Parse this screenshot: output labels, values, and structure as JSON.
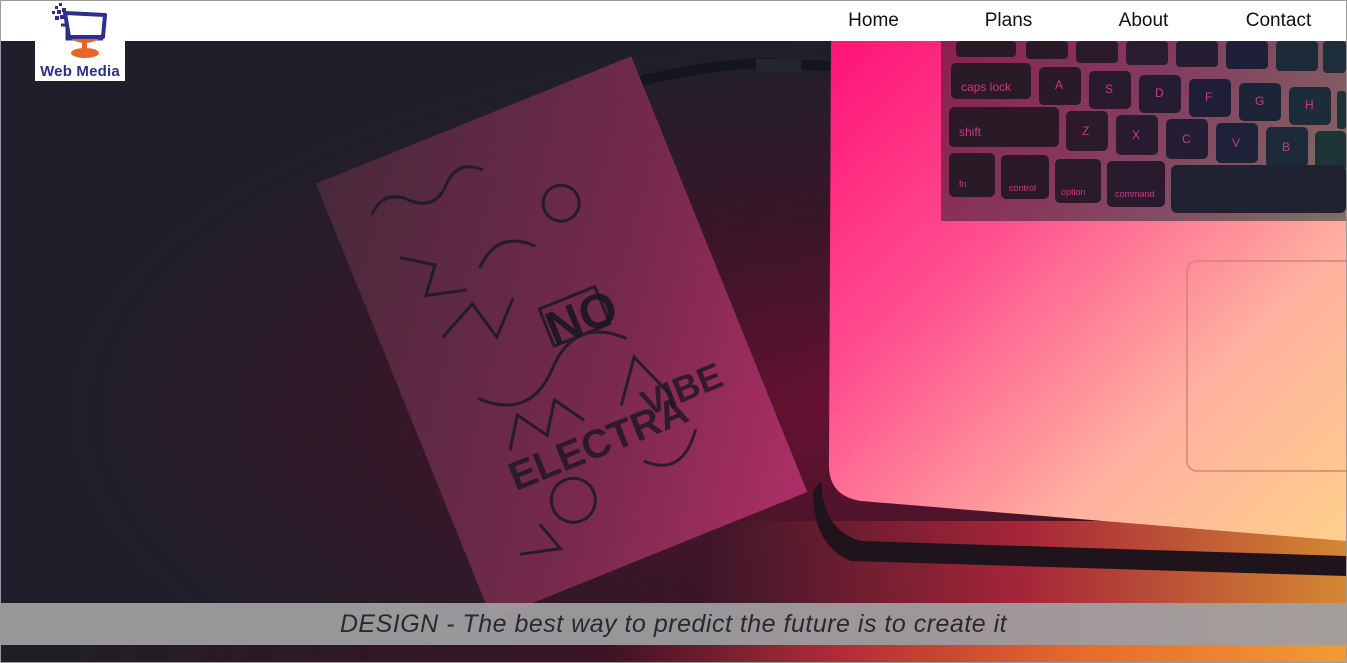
{
  "brand": {
    "name": "Web Media",
    "logo_icon": "monitor-icon",
    "logo_colors": {
      "primary": "#2d2f88",
      "accent": "#e8642a"
    }
  },
  "nav": {
    "items": [
      {
        "label": "Home"
      },
      {
        "label": "Plans"
      },
      {
        "label": "About"
      },
      {
        "label": "Contact"
      }
    ]
  },
  "hero": {
    "caption": "DESIGN - The best way to predict the future is to create it",
    "keyboard_keys": [
      {
        "label": "caps lock"
      },
      {
        "label": "A"
      },
      {
        "label": "S"
      },
      {
        "label": "D"
      },
      {
        "label": "F"
      },
      {
        "label": "G"
      },
      {
        "label": "H"
      },
      {
        "label": "shift"
      },
      {
        "label": "Z"
      },
      {
        "label": "X"
      },
      {
        "label": "C"
      },
      {
        "label": "V"
      },
      {
        "label": "B"
      },
      {
        "label": "fn"
      },
      {
        "label": "control"
      },
      {
        "label": "option"
      },
      {
        "label": "command"
      }
    ],
    "colors": {
      "dark": "#1f1f2b",
      "pink": "#ff1f7a",
      "orange": "#f7a23c"
    }
  }
}
